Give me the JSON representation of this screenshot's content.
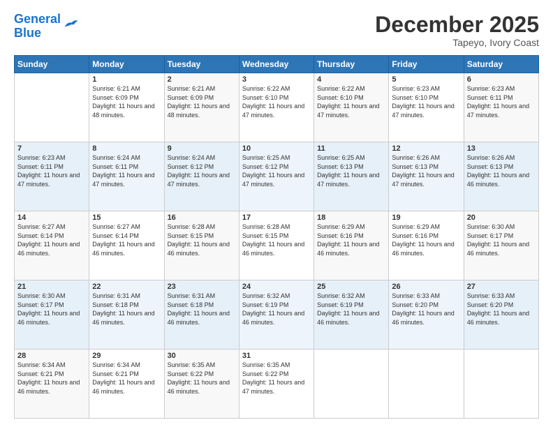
{
  "header": {
    "logo_general": "General",
    "logo_blue": "Blue",
    "month": "December 2025",
    "location": "Tapeyo, Ivory Coast"
  },
  "days_of_week": [
    "Sunday",
    "Monday",
    "Tuesday",
    "Wednesday",
    "Thursday",
    "Friday",
    "Saturday"
  ],
  "weeks": [
    [
      {
        "day": "",
        "sunrise": "",
        "sunset": "",
        "daylight": ""
      },
      {
        "day": "1",
        "sunrise": "Sunrise: 6:21 AM",
        "sunset": "Sunset: 6:09 PM",
        "daylight": "Daylight: 11 hours and 48 minutes."
      },
      {
        "day": "2",
        "sunrise": "Sunrise: 6:21 AM",
        "sunset": "Sunset: 6:09 PM",
        "daylight": "Daylight: 11 hours and 48 minutes."
      },
      {
        "day": "3",
        "sunrise": "Sunrise: 6:22 AM",
        "sunset": "Sunset: 6:10 PM",
        "daylight": "Daylight: 11 hours and 47 minutes."
      },
      {
        "day": "4",
        "sunrise": "Sunrise: 6:22 AM",
        "sunset": "Sunset: 6:10 PM",
        "daylight": "Daylight: 11 hours and 47 minutes."
      },
      {
        "day": "5",
        "sunrise": "Sunrise: 6:23 AM",
        "sunset": "Sunset: 6:10 PM",
        "daylight": "Daylight: 11 hours and 47 minutes."
      },
      {
        "day": "6",
        "sunrise": "Sunrise: 6:23 AM",
        "sunset": "Sunset: 6:11 PM",
        "daylight": "Daylight: 11 hours and 47 minutes."
      }
    ],
    [
      {
        "day": "7",
        "sunrise": "Sunrise: 6:23 AM",
        "sunset": "Sunset: 6:11 PM",
        "daylight": "Daylight: 11 hours and 47 minutes."
      },
      {
        "day": "8",
        "sunrise": "Sunrise: 6:24 AM",
        "sunset": "Sunset: 6:11 PM",
        "daylight": "Daylight: 11 hours and 47 minutes."
      },
      {
        "day": "9",
        "sunrise": "Sunrise: 6:24 AM",
        "sunset": "Sunset: 6:12 PM",
        "daylight": "Daylight: 11 hours and 47 minutes."
      },
      {
        "day": "10",
        "sunrise": "Sunrise: 6:25 AM",
        "sunset": "Sunset: 6:12 PM",
        "daylight": "Daylight: 11 hours and 47 minutes."
      },
      {
        "day": "11",
        "sunrise": "Sunrise: 6:25 AM",
        "sunset": "Sunset: 6:13 PM",
        "daylight": "Daylight: 11 hours and 47 minutes."
      },
      {
        "day": "12",
        "sunrise": "Sunrise: 6:26 AM",
        "sunset": "Sunset: 6:13 PM",
        "daylight": "Daylight: 11 hours and 47 minutes."
      },
      {
        "day": "13",
        "sunrise": "Sunrise: 6:26 AM",
        "sunset": "Sunset: 6:13 PM",
        "daylight": "Daylight: 11 hours and 46 minutes."
      }
    ],
    [
      {
        "day": "14",
        "sunrise": "Sunrise: 6:27 AM",
        "sunset": "Sunset: 6:14 PM",
        "daylight": "Daylight: 11 hours and 46 minutes."
      },
      {
        "day": "15",
        "sunrise": "Sunrise: 6:27 AM",
        "sunset": "Sunset: 6:14 PM",
        "daylight": "Daylight: 11 hours and 46 minutes."
      },
      {
        "day": "16",
        "sunrise": "Sunrise: 6:28 AM",
        "sunset": "Sunset: 6:15 PM",
        "daylight": "Daylight: 11 hours and 46 minutes."
      },
      {
        "day": "17",
        "sunrise": "Sunrise: 6:28 AM",
        "sunset": "Sunset: 6:15 PM",
        "daylight": "Daylight: 11 hours and 46 minutes."
      },
      {
        "day": "18",
        "sunrise": "Sunrise: 6:29 AM",
        "sunset": "Sunset: 6:16 PM",
        "daylight": "Daylight: 11 hours and 46 minutes."
      },
      {
        "day": "19",
        "sunrise": "Sunrise: 6:29 AM",
        "sunset": "Sunset: 6:16 PM",
        "daylight": "Daylight: 11 hours and 46 minutes."
      },
      {
        "day": "20",
        "sunrise": "Sunrise: 6:30 AM",
        "sunset": "Sunset: 6:17 PM",
        "daylight": "Daylight: 11 hours and 46 minutes."
      }
    ],
    [
      {
        "day": "21",
        "sunrise": "Sunrise: 6:30 AM",
        "sunset": "Sunset: 6:17 PM",
        "daylight": "Daylight: 11 hours and 46 minutes."
      },
      {
        "day": "22",
        "sunrise": "Sunrise: 6:31 AM",
        "sunset": "Sunset: 6:18 PM",
        "daylight": "Daylight: 11 hours and 46 minutes."
      },
      {
        "day": "23",
        "sunrise": "Sunrise: 6:31 AM",
        "sunset": "Sunset: 6:18 PM",
        "daylight": "Daylight: 11 hours and 46 minutes."
      },
      {
        "day": "24",
        "sunrise": "Sunrise: 6:32 AM",
        "sunset": "Sunset: 6:19 PM",
        "daylight": "Daylight: 11 hours and 46 minutes."
      },
      {
        "day": "25",
        "sunrise": "Sunrise: 6:32 AM",
        "sunset": "Sunset: 6:19 PM",
        "daylight": "Daylight: 11 hours and 46 minutes."
      },
      {
        "day": "26",
        "sunrise": "Sunrise: 6:33 AM",
        "sunset": "Sunset: 6:20 PM",
        "daylight": "Daylight: 11 hours and 46 minutes."
      },
      {
        "day": "27",
        "sunrise": "Sunrise: 6:33 AM",
        "sunset": "Sunset: 6:20 PM",
        "daylight": "Daylight: 11 hours and 46 minutes."
      }
    ],
    [
      {
        "day": "28",
        "sunrise": "Sunrise: 6:34 AM",
        "sunset": "Sunset: 6:21 PM",
        "daylight": "Daylight: 11 hours and 46 minutes."
      },
      {
        "day": "29",
        "sunrise": "Sunrise: 6:34 AM",
        "sunset": "Sunset: 6:21 PM",
        "daylight": "Daylight: 11 hours and 46 minutes."
      },
      {
        "day": "30",
        "sunrise": "Sunrise: 6:35 AM",
        "sunset": "Sunset: 6:22 PM",
        "daylight": "Daylight: 11 hours and 46 minutes."
      },
      {
        "day": "31",
        "sunrise": "Sunrise: 6:35 AM",
        "sunset": "Sunset: 6:22 PM",
        "daylight": "Daylight: 11 hours and 47 minutes."
      },
      {
        "day": "",
        "sunrise": "",
        "sunset": "",
        "daylight": ""
      },
      {
        "day": "",
        "sunrise": "",
        "sunset": "",
        "daylight": ""
      },
      {
        "day": "",
        "sunrise": "",
        "sunset": "",
        "daylight": ""
      }
    ]
  ]
}
